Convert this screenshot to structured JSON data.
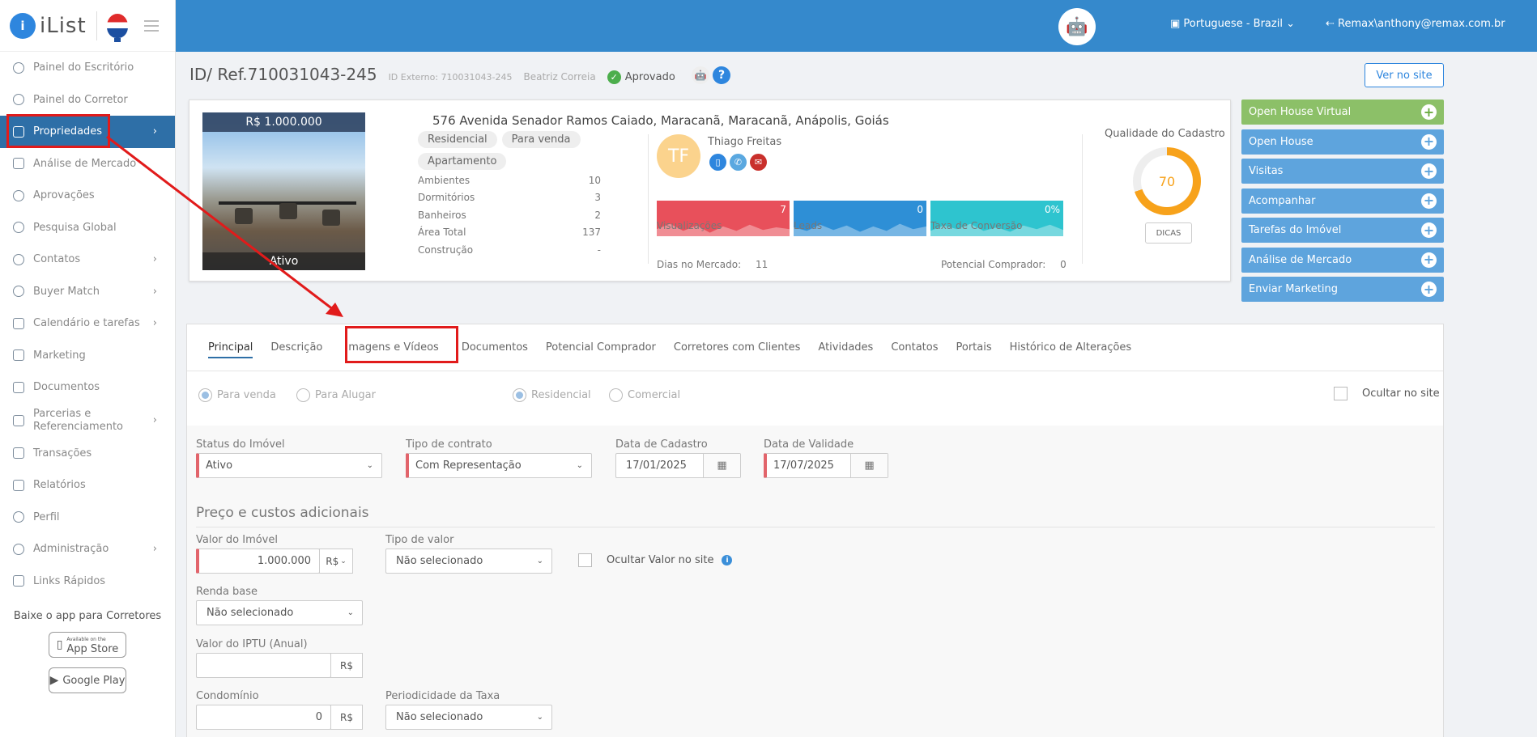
{
  "app": {
    "brand_badge": "i",
    "brand_name": "iList"
  },
  "sidebar": {
    "items": [
      {
        "label": "Painel do Escritório"
      },
      {
        "label": "Painel do Corretor"
      },
      {
        "label": "Propriedades"
      },
      {
        "label": "Análise de Mercado"
      },
      {
        "label": "Aprovações"
      },
      {
        "label": "Pesquisa Global"
      },
      {
        "label": "Contatos"
      },
      {
        "label": "Buyer Match"
      },
      {
        "label": "Calendário e tarefas"
      },
      {
        "label": "Marketing"
      },
      {
        "label": "Documentos"
      },
      {
        "label": "Parcerias e Referenciamento"
      },
      {
        "label": "Transações"
      },
      {
        "label": "Relatórios"
      },
      {
        "label": "Perfil"
      },
      {
        "label": "Administração"
      },
      {
        "label": "Links Rápidos"
      }
    ],
    "app_promo": "Baixe o app para Corretores",
    "app_store": "App Store",
    "app_store_small": "Available on the",
    "google_play": "Google Play"
  },
  "header": {
    "language": "Portuguese - Brazil",
    "user": "Remax\\anthony@remax.com.br"
  },
  "property": {
    "title": "ID/ Ref.710031043-245",
    "external_id": "ID Externo: 710031043-245",
    "owner": "Beatriz Correia",
    "status_label": "Aprovado",
    "view_site": "Ver no site",
    "price": "R$ 1.000.000",
    "photo_status": "Ativo",
    "address": "576 Avenida Senador Ramos Caiado, Maracanã, Maracanã, Anápolis, Goiás",
    "tags": [
      "Residencial",
      "Para venda",
      "Apartamento"
    ],
    "specs": [
      {
        "label": "Ambientes",
        "value": "10"
      },
      {
        "label": "Dormitórios",
        "value": "3"
      },
      {
        "label": "Banheiros",
        "value": "2"
      },
      {
        "label": "Área Total",
        "value": "137"
      },
      {
        "label": "Construção",
        "value": "-"
      }
    ],
    "agent": {
      "initials": "TF",
      "name": "Thiago Freitas"
    },
    "stats": [
      {
        "value": "7",
        "label": "Visualizações",
        "color": "#e8505b"
      },
      {
        "value": "0",
        "label": "Leads",
        "color": "#2e8fd6"
      },
      {
        "value": "0%",
        "label": "Taxa de Conversão",
        "color": "#2ec4cf"
      }
    ],
    "days_label": "Dias no Mercado:",
    "days_value": "11",
    "potential_label": "Potencial Comprador:",
    "potential_value": "0",
    "quality_title": "Qualidade do Cadastro",
    "quality_value": "70",
    "tips": "DICAS"
  },
  "actions": [
    {
      "label": "Open House Virtual"
    },
    {
      "label": "Open House"
    },
    {
      "label": "Visitas"
    },
    {
      "label": "Acompanhar"
    },
    {
      "label": "Tarefas do Imóvel"
    },
    {
      "label": "Análise de Mercado"
    },
    {
      "label": "Enviar Marketing"
    }
  ],
  "tabs": [
    {
      "label": "Principal"
    },
    {
      "label": "Descrição"
    },
    {
      "label": "Imagens e Vídeos"
    },
    {
      "label": "Documentos"
    },
    {
      "label": "Potencial Comprador"
    },
    {
      "label": "Corretores com Clientes"
    },
    {
      "label": "Atividades"
    },
    {
      "label": "Contatos"
    },
    {
      "label": "Portais"
    },
    {
      "label": "Histórico de Alterações"
    }
  ],
  "form": {
    "for_sale": "Para venda",
    "for_rent": "Para Alugar",
    "residential": "Residencial",
    "commercial": "Comercial",
    "hide_site": "Ocultar no site",
    "status_label": "Status do Imóvel",
    "status_value": "Ativo",
    "contract_label": "Tipo de contrato",
    "contract_value": "Com Representação",
    "reg_date_label": "Data de Cadastro",
    "reg_date_value": "17/01/2025",
    "valid_date_label": "Data de Validade",
    "valid_date_value": "17/07/2025",
    "section_price": "Preço e custos adicionais",
    "value_label": "Valor do Imóvel",
    "value_value": "1.000.000",
    "currency": "R$",
    "value_type_label": "Tipo de valor",
    "value_type_value": "Não selecionado",
    "hide_value": "Ocultar Valor no site",
    "base_income_label": "Renda base",
    "base_income_value": "Não selecionado",
    "iptu_label": "Valor do IPTU (Anual)",
    "iptu_value": "",
    "condo_label": "Condomínio",
    "condo_value": "0",
    "fee_period_label": "Periodicidade da Taxa",
    "fee_period_value": "Não selecionado"
  }
}
